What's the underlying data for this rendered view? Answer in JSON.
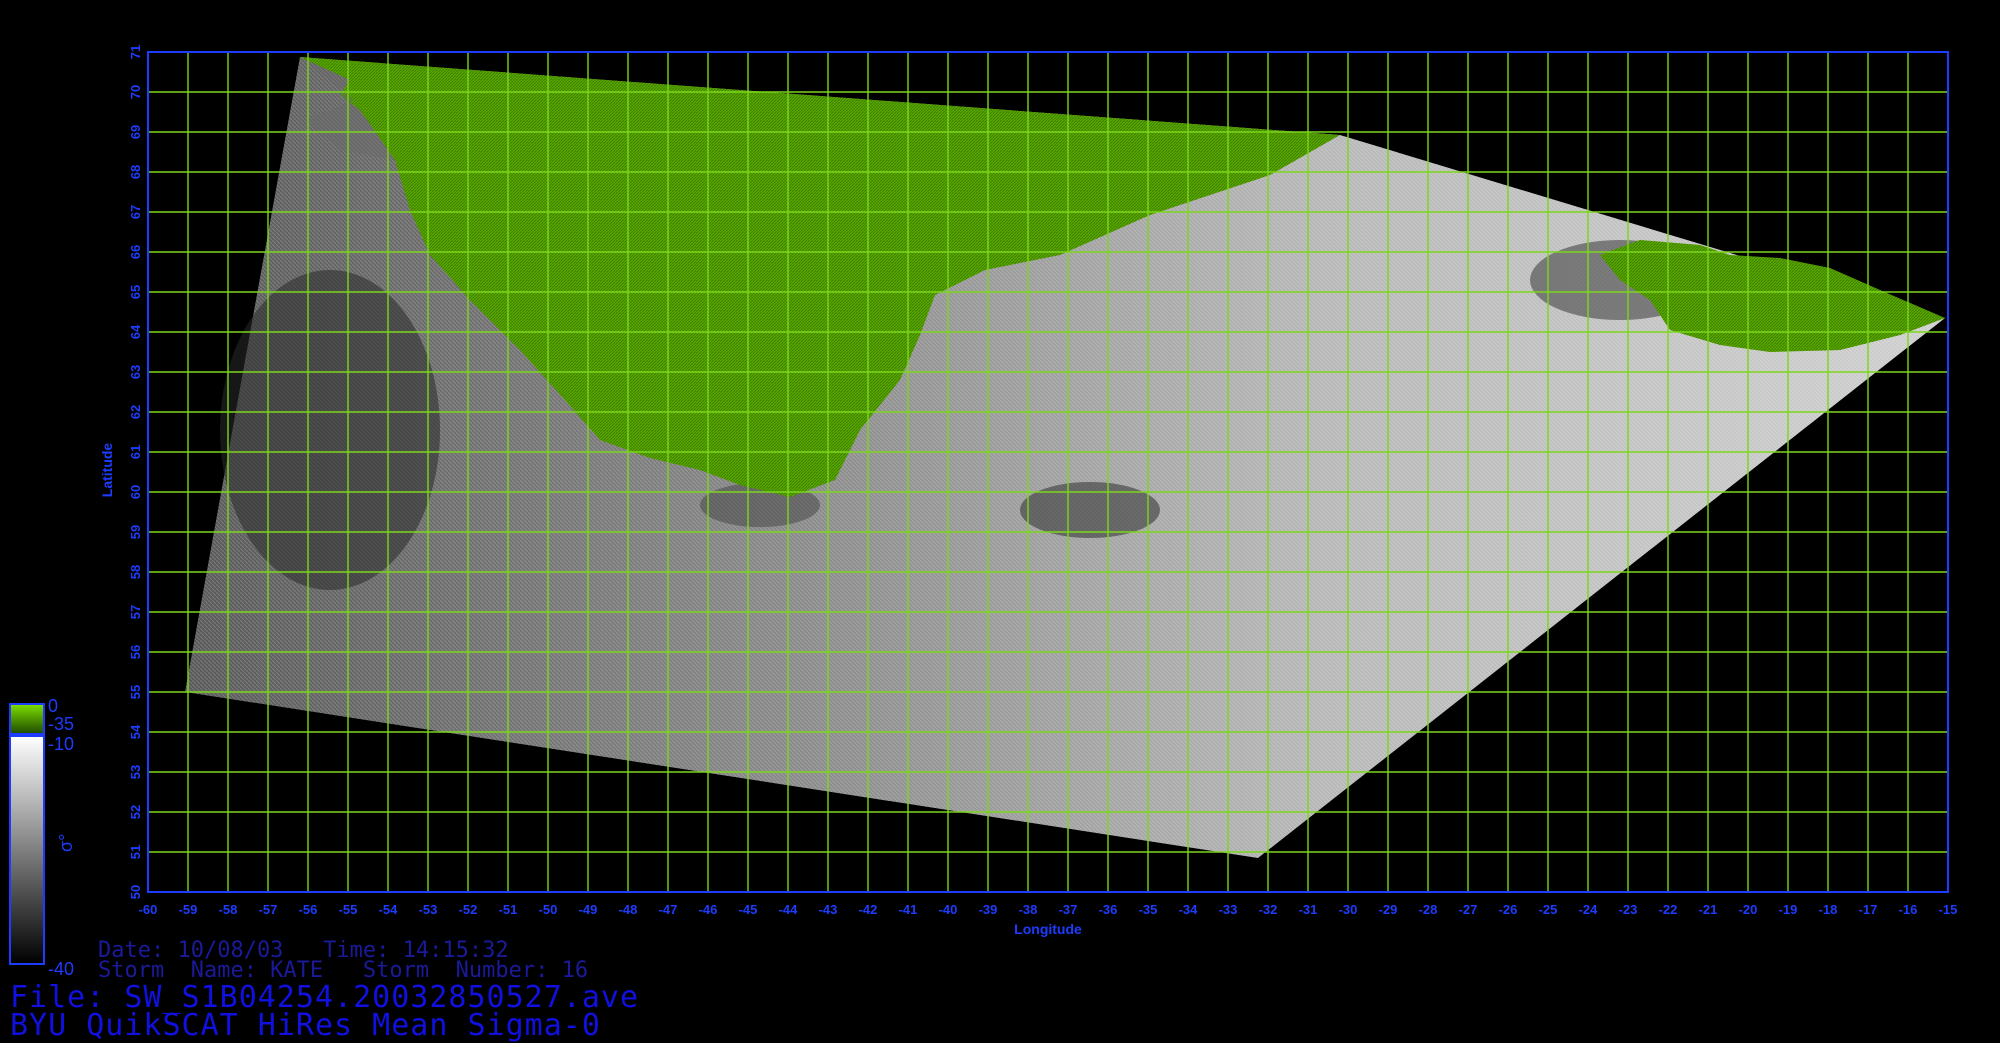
{
  "map": {
    "longitudes": [
      "-60",
      "-59",
      "-58",
      "-57",
      "-56",
      "-55",
      "-54",
      "-53",
      "-52",
      "-51",
      "-50",
      "-49",
      "-48",
      "-47",
      "-46",
      "-45",
      "-44",
      "-43",
      "-42",
      "-41",
      "-40",
      "-39",
      "-38",
      "-37",
      "-36",
      "-35",
      "-34",
      "-33",
      "-32",
      "-31",
      "-30",
      "-29",
      "-28",
      "-27",
      "-26",
      "-25",
      "-24",
      "-23",
      "-22",
      "-21",
      "-20",
      "-19",
      "-18",
      "-17",
      "-16",
      "-15"
    ],
    "latitudes": [
      "71",
      "70",
      "69",
      "68",
      "67",
      "66",
      "65",
      "64",
      "63",
      "62",
      "61",
      "60",
      "59",
      "58",
      "57",
      "56",
      "55",
      "54",
      "53",
      "52",
      "51",
      "50"
    ],
    "xlabel": "Longitude",
    "ylabel": "Latitude",
    "colors": {
      "grid": "#7cd61c",
      "frame": "#1e3cff",
      "tick_text": "#1e3cff",
      "land": "#58a800",
      "sea_light": "#d8d8d8",
      "sea_dark": "#555555"
    }
  },
  "colorbar": {
    "land_top": "0",
    "land_bottom": "-35",
    "sea_top": "-10",
    "sea_bottom": "-40",
    "symbol": "σ°"
  },
  "info": {
    "date_line": "Date: 10/08/03   Time: 14:15:32",
    "storm_line": "Storm  Name: KATE   Storm  Number: 16",
    "file_line": "File: SW_S1B04254.20032850527.ave",
    "product_line": "BYU QuikSCAT HiRes Mean Sigma-0"
  }
}
